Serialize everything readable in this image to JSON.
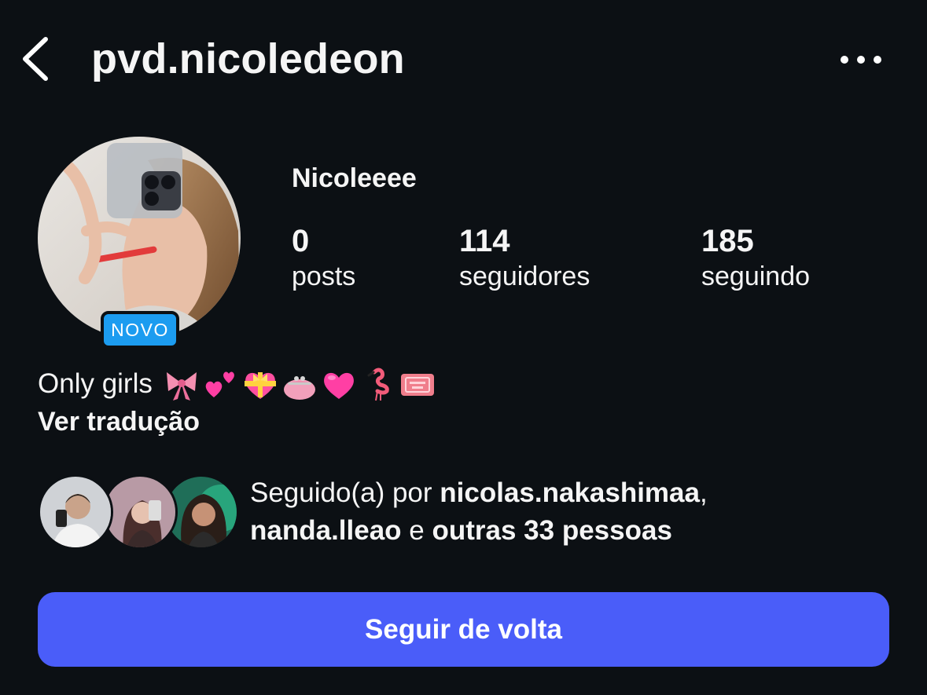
{
  "header": {
    "username": "pvd.nicoledeon",
    "back_icon": "chevron-left-icon",
    "more_icon": "more-horizontal-icon"
  },
  "profile": {
    "display_name": "Nicoleeee",
    "badge": "NOVO",
    "stats": [
      {
        "value": "0",
        "label": "posts"
      },
      {
        "value": "114",
        "label": "seguidores"
      },
      {
        "value": "185",
        "label": "seguindo"
      }
    ]
  },
  "bio": {
    "text": "Only girls",
    "emojis": [
      "ribbon-icon",
      "two-hearts-icon",
      "heart-with-ribbon-icon",
      "purse-icon",
      "pink-heart-icon",
      "flamingo-icon",
      "admission-ticket-icon"
    ],
    "translate_label": "Ver tradução"
  },
  "followed_by": {
    "prefix": "Seguido(a) por ",
    "user1": "nicolas.nakashimaa",
    "sep1": ",",
    "user2": "nanda.lleao",
    "conj": " e ",
    "others": "outras 33 pessoas"
  },
  "actions": {
    "follow_back_label": "Seguir de volta"
  },
  "colors": {
    "background": "#0c1014",
    "badge": "#1c9cf0",
    "follow_button": "#4a5df9",
    "text": "#f5f5f5"
  }
}
